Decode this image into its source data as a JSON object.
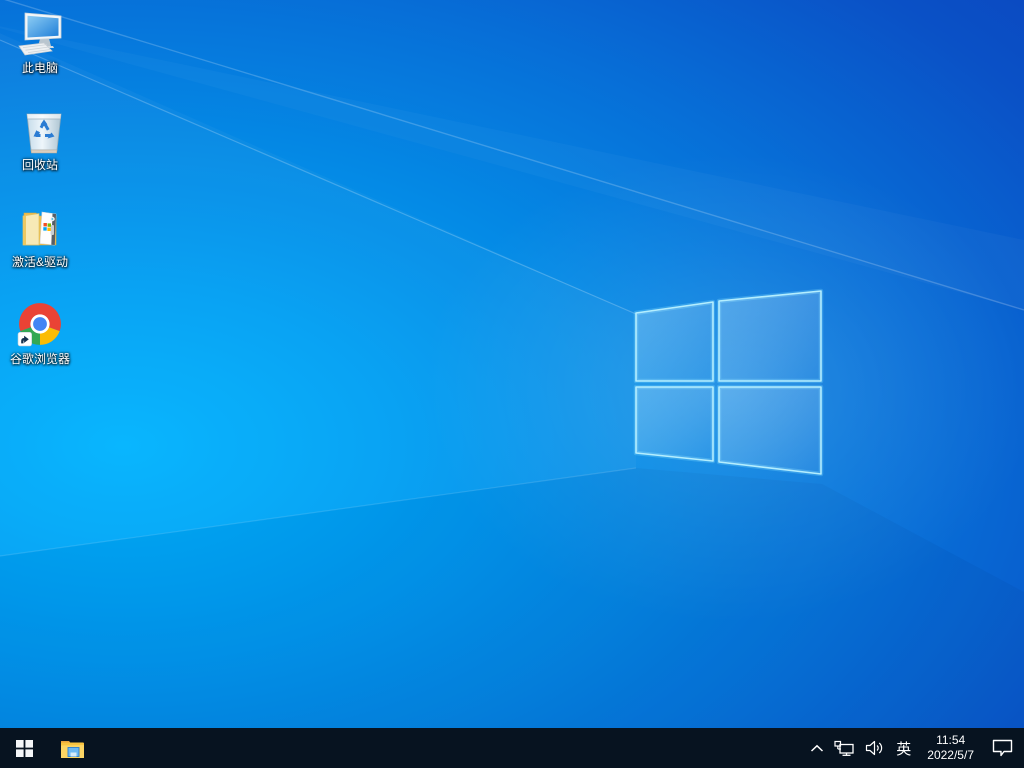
{
  "desktop": {
    "icons": [
      {
        "label": "此电脑"
      },
      {
        "label": "回收站"
      },
      {
        "label": "激活&驱动"
      },
      {
        "label": "谷歌浏览器"
      }
    ]
  },
  "taskbar": {
    "language_indicator": "英",
    "clock": {
      "time": "11:54",
      "date": "2022/5/7"
    }
  },
  "colors": {
    "wallpaper_light": "#00b4fe",
    "wallpaper_mid": "#0489e5",
    "wallpaper_dark_corner": "#0d3eba",
    "logo_edge": "#a9ecff",
    "taskbar_bg": "#071320",
    "chrome_red": "#ea4335",
    "chrome_yellow": "#fbbc05",
    "chrome_green": "#34a853",
    "chrome_blue": "#4285f4",
    "folder_yellow": "#f9c440",
    "explorer_tray_blue": "#6cb9f5"
  }
}
